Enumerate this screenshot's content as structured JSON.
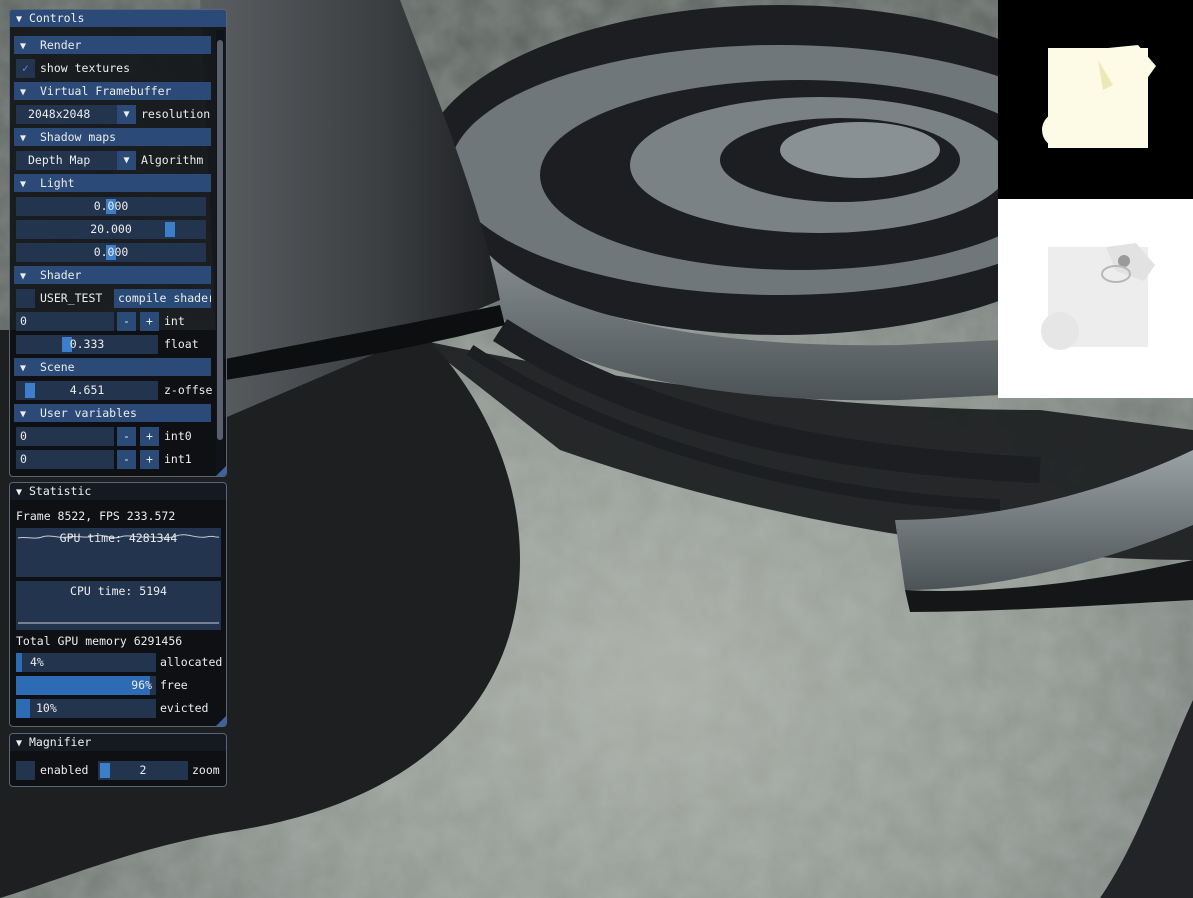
{
  "controls": {
    "title": "Controls",
    "render": {
      "header": "Render",
      "show_textures": {
        "label": "show textures",
        "checked": true
      }
    },
    "virtual_framebuffer": {
      "header": "Virtual Framebuffer",
      "resolution": {
        "value": "2048x2048",
        "label": "resolution"
      }
    },
    "shadow_maps": {
      "header": "Shadow maps",
      "algorithm": {
        "value": "Depth Map",
        "label": "Algorithm"
      }
    },
    "light": {
      "header": "Light",
      "sliders": [
        {
          "text": "0.000",
          "value": 0.0,
          "min": -20,
          "max": 20
        },
        {
          "text": "20.000",
          "value": 20.0,
          "min": -20,
          "max": 20
        },
        {
          "text": "0.000",
          "value": 0.0,
          "min": -20,
          "max": 20
        }
      ]
    },
    "shader": {
      "header": "Shader",
      "user_test": {
        "label": "USER_TEST",
        "checked": false
      },
      "compile_button": "compile shader",
      "int_input": {
        "value": "0",
        "minus": "-",
        "plus": "+",
        "label": "int"
      },
      "float_slider": {
        "text": "0.333",
        "value": 0.333,
        "label": "float"
      }
    },
    "scene": {
      "header": "Scene",
      "z_offset": {
        "text": "4.651",
        "label": "z-offset",
        "fraction": 0.05
      }
    },
    "user_variables": {
      "header": "User variables",
      "ints": [
        {
          "value": "0",
          "minus": "-",
          "plus": "+",
          "label": "int0"
        },
        {
          "value": "0",
          "minus": "-",
          "plus": "+",
          "label": "int1"
        }
      ]
    }
  },
  "statistic": {
    "title": "Statistic",
    "frame_line": "Frame 8522, FPS 233.572",
    "gpu_time": "GPU time: 4281344",
    "cpu_time": "CPU time: 5194",
    "total_gpu_memory": "Total GPU memory 6291456",
    "bars": [
      {
        "text": "4%",
        "label": "allocated",
        "fraction": 0.04
      },
      {
        "text": "96%",
        "label": "free",
        "fraction": 0.96
      },
      {
        "text": "10%",
        "label": "evicted",
        "fraction": 0.1
      }
    ]
  },
  "magnifier": {
    "title": "Magnifier",
    "enabled": {
      "label": "enabled",
      "checked": false
    },
    "zoom": {
      "text": "2",
      "label": "zoom",
      "fraction": 0.05
    }
  },
  "glyphs": {
    "collapse": "▼",
    "check": "✓",
    "combo_arrow": "▼"
  },
  "colors": {
    "accent": "#3d7ecb",
    "header": "#2b4a78",
    "frame": "#23344e"
  }
}
